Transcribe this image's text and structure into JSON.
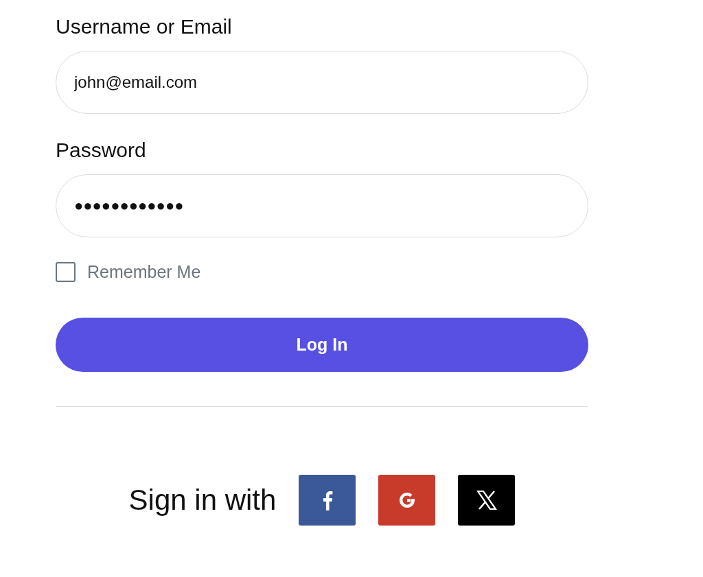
{
  "fields": [
    {
      "label": "Username or Email",
      "value": "john@email.com"
    },
    {
      "label": "Password",
      "value": "●●●●●●●●●●●●"
    }
  ],
  "remember": {
    "label": "Remember Me",
    "checked": false
  },
  "login_button": "Log In",
  "social": {
    "label": "Sign in with",
    "buttons": [
      {
        "kind": "facebook",
        "color": "#3b5998"
      },
      {
        "kind": "google",
        "color": "#c83a2a"
      },
      {
        "kind": "x",
        "color": "#000000"
      }
    ]
  }
}
